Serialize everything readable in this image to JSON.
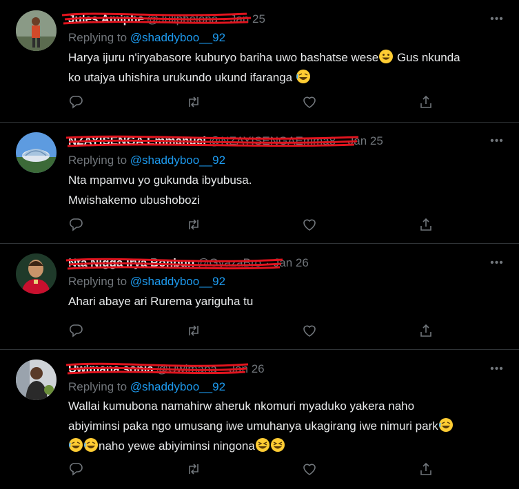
{
  "tweets": [
    {
      "name": "Jules Amiphe",
      "handle": "@Juliphelona",
      "date": "Jan 25",
      "replying_prefix": "Replying to ",
      "replying_handle": "@shaddyboo__92",
      "text_line1": "Harya ijuru n'iryabasore kuburyo bariha uwo bashatse wese",
      "text_line1_tail": " Gus nkunda",
      "text_line2": "ko utajya uhishira urukundo ukund ifaranga "
    },
    {
      "name": "NZAYISENGA Emmanuel",
      "handle": "@NZAYISENGAEmma8",
      "date": "Jan 25",
      "replying_prefix": "Replying to ",
      "replying_handle": "@shaddyboo__92",
      "text_line1": "Nta mpamvu yo gukunda ibyubusa.",
      "text_line2": "Mwishakemo ubushobozi"
    },
    {
      "name": "Nta Nigga Irya Bonbun",
      "handle": "@GyazaBro",
      "date": "Jan 26",
      "replying_prefix": "Replying to ",
      "replying_handle": "@shaddyboo__92",
      "text_line1": "Ahari abaye ari Rurema yariguha tu"
    },
    {
      "name": "Uwimana sonia",
      "handle": "@Uwimana",
      "date": "Jan 26",
      "replying_prefix": "Replying to ",
      "replying_handle": "@shaddyboo__92",
      "text_line1": "Wallai kumubona namahirw aheruk nkomuri myaduko yakera naho",
      "text_line2": "abiyiminsi paka ngo umusang iwe umuhanya ukagirang iwe nimuri park",
      "text_line3": "naho yewe abiyiminsi ningona"
    }
  ],
  "icons": {
    "reply": "reply-icon",
    "retweet": "retweet-icon",
    "like": "like-icon",
    "share": "share-icon",
    "more": "more-icon"
  },
  "colors": {
    "background": "#000000",
    "text": "#e7e9ea",
    "muted": "#71767b",
    "link": "#1d9bf0",
    "divider": "#2f3336",
    "redaction": "#e0141e"
  }
}
